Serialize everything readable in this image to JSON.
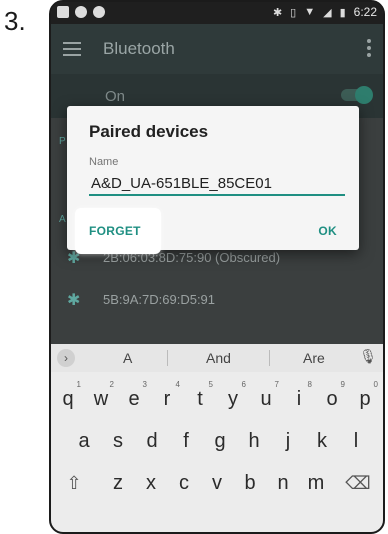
{
  "step_label": "3.",
  "status_bar": {
    "time": "6:22"
  },
  "app_bar": {
    "title": "Bluetooth"
  },
  "on_row": {
    "label": "On"
  },
  "background_sections": {
    "paired_letter": "P",
    "available_letter": "A"
  },
  "background_list": [
    {
      "text": "2B:06:03:8D:75:90 (Obscured)"
    },
    {
      "text": "5B:9A:7D:69:D5:91"
    }
  ],
  "dialog": {
    "title": "Paired devices",
    "name_label": "Name",
    "name_value": "A&D_UA-651BLE_85CE01",
    "forget_label": "FORGET",
    "ok_label": "OK"
  },
  "keyboard": {
    "suggestions": [
      "A",
      "And",
      "Are"
    ],
    "row1": [
      {
        "key": "q",
        "hint": "1"
      },
      {
        "key": "w",
        "hint": "2"
      },
      {
        "key": "e",
        "hint": "3"
      },
      {
        "key": "r",
        "hint": "4"
      },
      {
        "key": "t",
        "hint": "5"
      },
      {
        "key": "y",
        "hint": "6"
      },
      {
        "key": "u",
        "hint": "7"
      },
      {
        "key": "i",
        "hint": "8"
      },
      {
        "key": "o",
        "hint": "9"
      },
      {
        "key": "p",
        "hint": "0"
      }
    ],
    "row2": [
      "a",
      "s",
      "d",
      "f",
      "g",
      "h",
      "j",
      "k",
      "l"
    ],
    "row3": [
      "z",
      "x",
      "c",
      "v",
      "b",
      "n",
      "m"
    ],
    "shift_glyph": "⇧",
    "backspace_glyph": "⌫"
  },
  "colors": {
    "accent": "#1f8f82",
    "dialog_bg": "#f5f5f5",
    "app_bar": "#2f3a3a"
  }
}
